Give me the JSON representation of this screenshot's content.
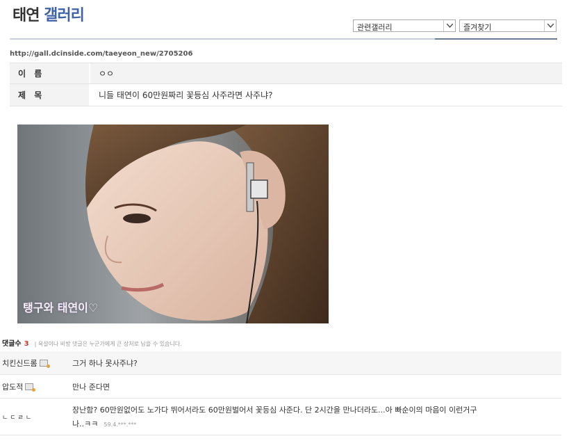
{
  "header": {
    "title_part1": "태연",
    "title_part2": "갤러리"
  },
  "selects": [
    {
      "label": "관련갤러리",
      "icon": "chevron-down-icon"
    },
    {
      "label": "즐겨찾기",
      "icon": "chevron-down-icon"
    }
  ],
  "url": "http://gall.dcinside.com/taeyeon_new/2705206",
  "post": {
    "name_label": "이 름",
    "name_value": "ㅇㅇ",
    "subject_label": "제 목",
    "subject_value": "니들 태연이 60만원짜리 꽃등심 사주라면 사주냐?"
  },
  "image": {
    "caption": "탱구와 태연이♡"
  },
  "comments_header": {
    "label": "댓글수",
    "count": "3",
    "note": "| 욕설이나 비방 댓글은 누군가에게 큰 상처로 남을 수 있습니다."
  },
  "comments": [
    {
      "nick": "치킨신드롬",
      "text": "그거 하나 못사주냐?"
    },
    {
      "nick": "압도적",
      "text": "만나 준다면"
    },
    {
      "nick": "ㄴㄷㄹㄴ",
      "text": "장난함? 60만원없어도 노가다 뛰어서라도 60만원벌어서 꽃등심 사준다. 단 2시간을 만나더라도...아 빠순이의 마음이 이런거구",
      "text2": "나..ㅋㅋ",
      "meta": "59.4.***.***"
    }
  ]
}
